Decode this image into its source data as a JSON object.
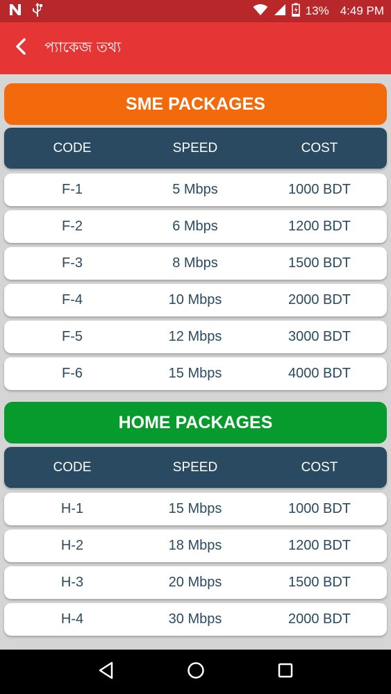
{
  "status_bar": {
    "battery_percent": "13%",
    "time": "4:49 PM"
  },
  "app_bar": {
    "title": "প্যাকেজ তথ্য"
  },
  "columns": {
    "code": "CODE",
    "speed": "SPEED",
    "cost": "COST"
  },
  "sme": {
    "title": "SME PACKAGES",
    "color": "#f26a0b",
    "rows": [
      {
        "code": "F-1",
        "speed": "5 Mbps",
        "cost": "1000 BDT"
      },
      {
        "code": "F-2",
        "speed": "6 Mbps",
        "cost": "1200 BDT"
      },
      {
        "code": "F-3",
        "speed": "8 Mbps",
        "cost": "1500 BDT"
      },
      {
        "code": "F-4",
        "speed": "10 Mbps",
        "cost": "2000 BDT"
      },
      {
        "code": "F-5",
        "speed": "12 Mbps",
        "cost": "3000 BDT"
      },
      {
        "code": "F-6",
        "speed": "15 Mbps",
        "cost": "4000 BDT"
      }
    ]
  },
  "home": {
    "title": "HOME PACKAGES",
    "color": "#079a2c",
    "rows": [
      {
        "code": "H-1",
        "speed": "15 Mbps",
        "cost": "1000 BDT"
      },
      {
        "code": "H-2",
        "speed": "18 Mbps",
        "cost": "1200 BDT"
      },
      {
        "code": "H-3",
        "speed": "20 Mbps",
        "cost": "1500 BDT"
      },
      {
        "code": "H-4",
        "speed": "30 Mbps",
        "cost": "2000 BDT"
      }
    ]
  },
  "colors": {
    "status_bar": "#b8282a",
    "app_bar": "#e53635",
    "table_header": "#294a60",
    "row_text": "#294a60"
  }
}
